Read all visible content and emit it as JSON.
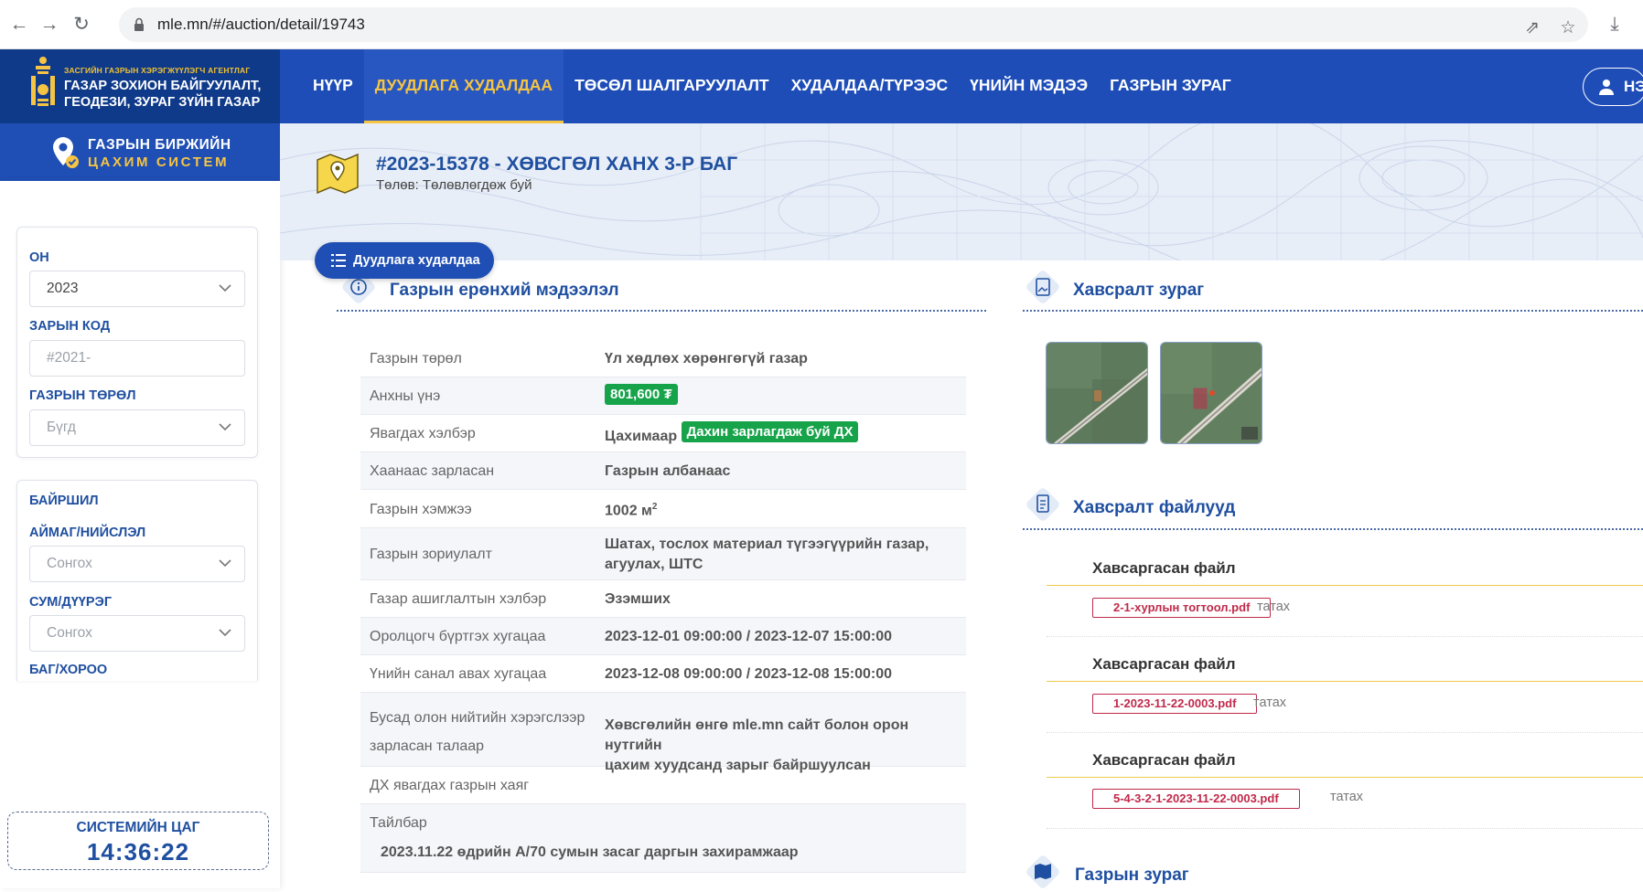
{
  "browser": {
    "url": "mle.mn/#/auction/detail/19743"
  },
  "header": {
    "agency_small": "ЗАСГИЙН ГАЗРЫН ХЭРЭГЖҮҮЛЭГЧ АГЕНТЛАГ",
    "agency_line1": "ГАЗАР ЗОХИОН БАЙГУУЛАЛТ,",
    "agency_line2": "ГЕОДЕЗИ, ЗУРАГ ЗҮЙН ГАЗАР",
    "nav": [
      "НҮҮР",
      "ДУУДЛАГА ХУДАЛДАА",
      "ТӨСӨЛ ШАЛГАРУУЛАЛТ",
      "ХУДАЛДАА/ТҮРЭЭС",
      "ҮНИЙН МЭДЭЭ",
      "ГАЗРЫН ЗУРАГ"
    ],
    "active_nav": 1,
    "user_label": "НЭ"
  },
  "sidebar": {
    "system_line1": "ГАЗРЫН БИРЖИЙН",
    "system_line2": "ЦАХИМ СИСТЕМ",
    "year_label": "ОН",
    "year_value": "2023",
    "code_label": "ЗАРЫН КОД",
    "code_placeholder": "#2021-",
    "type_label": "ГАЗРЫН ТӨРӨЛ",
    "type_value": "Бүгд",
    "location_label": "БАЙРШИЛ",
    "aimag_label": "АЙМАГ/НИЙСЛЭЛ",
    "aimag_value": "Сонгох",
    "sum_label": "СУМ/ДҮҮРЭГ",
    "sum_value": "Сонгох",
    "bag_label": "БАГ/ХОРОО",
    "clock_label": "СИСТЕМИЙН ЦАГ",
    "clock_time": "14:36:22"
  },
  "hero": {
    "title": "#2023-15378 - ХӨВСГӨЛ ХАНХ 3-Р БАГ",
    "status": "Төлөв: Төлөвлөгдөж буй",
    "pill": "Дуудлага худалдаа"
  },
  "general": {
    "title": "Газрын ерөнхий мэдээлэл",
    "rows": [
      {
        "k": "Газрын төрөл",
        "v": "Үл хөдлөх хөрөнгөгүй газар"
      },
      {
        "k": "Анхны үнэ",
        "v": "801,600 ₮"
      },
      {
        "k": "Явагдах хэлбэр",
        "v": "Цахимаар",
        "badge": "Дахин зарлагдаж буй ДХ"
      },
      {
        "k": "Хаанаас зарласан",
        "v": "Газрын албанаас"
      },
      {
        "k": "Газрын хэмжээ",
        "v": "1002 м",
        "sup": "2"
      },
      {
        "k": "Газрын зориулалт",
        "v": "Шатах, тослох материал түгээгүүрийн газар,",
        "v2": "агуулах, ШТС"
      },
      {
        "k": "Газар ашиглалтын хэлбэр",
        "v": "Эзэмших"
      },
      {
        "k": "Оролцогч бүртгэх хугацаа",
        "v": "2023-12-01 09:00:00 / 2023-12-07 15:00:00"
      },
      {
        "k": "Үнийн санал авах хугацаа",
        "v": "2023-12-08 09:00:00 / 2023-12-08 15:00:00"
      },
      {
        "k": "Бусад олон нийтийн хэрэгслээр",
        "k2": "зарласан талаар",
        "v": "Хөвсгөлийн өнгө mle.mn сайт болон орон нутгийн",
        "v2": "цахим хуудсанд зарыг байршуулсан"
      },
      {
        "k": "ДХ явагдах газрын хаяг",
        "v": ""
      },
      {
        "k": "Тайлбар",
        "v": "2023.11.22 өдрийн А/70 сумын засаг даргын захирамжаар"
      }
    ]
  },
  "attachments": {
    "images_title": "Хавсралт зураг",
    "files_title": "Хавсралт файлууд",
    "files": [
      {
        "heading": "Хавсаргасан файл",
        "name": "2-1-хурлын тогтоол.pdf",
        "download": "татах"
      },
      {
        "heading": "Хавсаргасан файл",
        "name": "1-2023-11-22-0003.pdf",
        "download": "татах"
      },
      {
        "heading": "Хавсаргасан файл",
        "name": "5-4-3-2-1-2023-11-22-0003.pdf",
        "download": "татах"
      }
    ],
    "map_title": "Газрын зураг"
  },
  "colors": {
    "brand_blue": "#1e4db7",
    "accent_yellow": "#f6c443",
    "price_green": "#16a34a",
    "file_red": "#c0294a"
  }
}
